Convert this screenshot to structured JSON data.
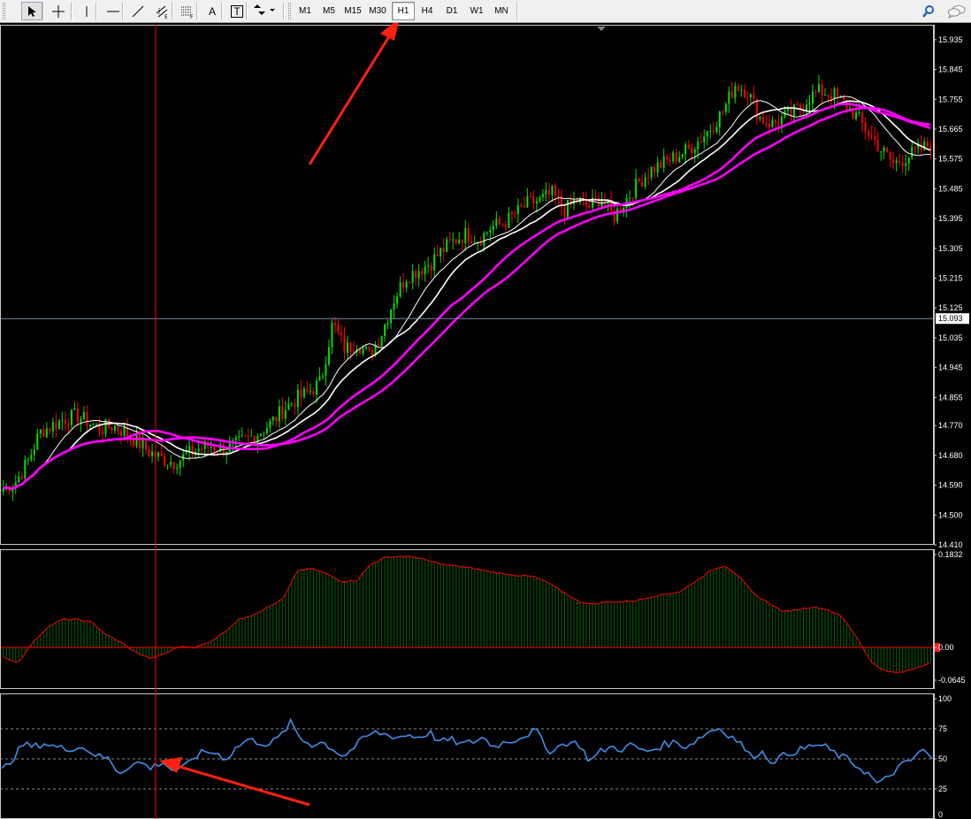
{
  "toolbar": {
    "tools": [
      {
        "name": "cursor-tool-button",
        "icon": "cursor-arrow-icon",
        "active": true
      },
      {
        "name": "crosshair-tool-button",
        "icon": "crosshair-icon",
        "active": false
      },
      {
        "name": "vertical-line-button",
        "icon": "vertical-line-icon",
        "active": false
      },
      {
        "name": "horizontal-line-button",
        "icon": "horizontal-line-icon",
        "active": false
      },
      {
        "name": "trendline-button",
        "icon": "trendline-icon",
        "active": false
      },
      {
        "name": "equidistant-channel-button",
        "icon": "channel-icon",
        "active": false
      },
      {
        "name": "fibonacci-button",
        "icon": "fibonacci-icon",
        "active": false
      },
      {
        "name": "text-tool-button",
        "icon": "text-icon",
        "active": false
      },
      {
        "name": "text-label-button",
        "icon": "text-label-icon",
        "active": false
      },
      {
        "name": "arrows-dropdown-button",
        "icon": "arrows-icon",
        "active": false
      }
    ],
    "text_tool_label": "A",
    "text_label_label": "T",
    "timeframes": [
      "M1",
      "M5",
      "M15",
      "M30",
      "H1",
      "H4",
      "D1",
      "W1",
      "MN"
    ],
    "active_timeframe": "H1",
    "right_icons": [
      "search-icon",
      "chat-icon"
    ]
  },
  "main_panel": {
    "price_labels": [
      "15.935",
      "15.845",
      "15.755",
      "15.665",
      "15.575",
      "15.485",
      "15.395",
      "15.305",
      "15.215",
      "15.125",
      "15.035",
      "14.945",
      "14.855",
      "14.770",
      "14.680",
      "14.590",
      "14.500",
      "14.410"
    ],
    "current_price_label": "15.093",
    "colors": {
      "bull": "#00e000",
      "bear": "#ff0000",
      "fast_ma": "#ffffff",
      "slow_ma": "#ff00ff",
      "crosshair_vertical": "#ff0000",
      "crosshair_horizontal": "#7a88aa"
    }
  },
  "macd_panel": {
    "labels": [
      "0.1832",
      "0.00",
      "-0.0645"
    ],
    "colors": {
      "hist_up": "#006400",
      "signal": "#ff0000",
      "zero_line": "#ff0000"
    }
  },
  "rsi_panel": {
    "labels": [
      "100",
      "75",
      "50",
      "25",
      "0"
    ],
    "colors": {
      "line": "#3e8ee8"
    }
  },
  "annotations": {
    "color": "#ff2010",
    "arrows": [
      {
        "name": "arrow-to-h1-timeframe",
        "points_to": "H1"
      },
      {
        "name": "arrow-to-rsi-crossing",
        "points_to": "RSI 50"
      }
    ]
  },
  "chart_data": [
    {
      "type": "candlestick",
      "title": "",
      "ylim": [
        14.41,
        15.98
      ],
      "y_ticks": [
        15.935,
        15.845,
        15.755,
        15.665,
        15.575,
        15.485,
        15.395,
        15.305,
        15.215,
        15.125,
        15.035,
        14.945,
        14.855,
        14.77,
        14.68,
        14.59,
        14.5,
        14.41
      ],
      "current_price": 15.093,
      "close_path": [
        14.58,
        14.6,
        14.66,
        14.75,
        14.77,
        14.79,
        14.8,
        14.78,
        14.76,
        14.77,
        14.75,
        14.72,
        14.69,
        14.67,
        14.66,
        14.68,
        14.7,
        14.71,
        14.7,
        14.71,
        14.73,
        14.75,
        14.78,
        14.82,
        14.85,
        14.87,
        14.9,
        15.08,
        15.0,
        15.02,
        14.98,
        15.05,
        15.15,
        15.22,
        15.24,
        15.26,
        15.3,
        15.33,
        15.35,
        15.33,
        15.37,
        15.38,
        15.41,
        15.44,
        15.45,
        15.47,
        15.42,
        15.45,
        15.43,
        15.46,
        15.4,
        15.45,
        15.5,
        15.54,
        15.56,
        15.58,
        15.6,
        15.63,
        15.67,
        15.72,
        15.8,
        15.78,
        15.7,
        15.68,
        15.7,
        15.72,
        15.76,
        15.78,
        15.77,
        15.74,
        15.7,
        15.65,
        15.6,
        15.56,
        15.58,
        15.6,
        15.62
      ],
      "moving_averages": [
        "fast",
        "fast",
        "slow",
        "slow"
      ]
    },
    {
      "type": "bar",
      "name": "MACD",
      "ylim": [
        -0.0645,
        0.1832
      ],
      "y_ticks": [
        0.1832,
        0.0,
        -0.0645
      ],
      "hist_path": [
        -0.02,
        -0.03,
        0.01,
        0.04,
        0.055,
        0.055,
        0.05,
        0.025,
        0.01,
        -0.01,
        -0.022,
        -0.012,
        0.002,
        0.0,
        0.01,
        0.03,
        0.055,
        0.065,
        0.08,
        0.095,
        0.152,
        0.155,
        0.145,
        0.13,
        0.132,
        0.165,
        0.178,
        0.18,
        0.178,
        0.17,
        0.163,
        0.16,
        0.155,
        0.15,
        0.145,
        0.142,
        0.14,
        0.128,
        0.11,
        0.092,
        0.085,
        0.09,
        0.09,
        0.092,
        0.1,
        0.105,
        0.11,
        0.13,
        0.15,
        0.162,
        0.14,
        0.105,
        0.088,
        0.07,
        0.075,
        0.08,
        0.075,
        0.06,
        0.02,
        -0.03,
        -0.048,
        -0.05,
        -0.04,
        -0.03
      ]
    },
    {
      "type": "line",
      "name": "RSI",
      "ylim": [
        0,
        100
      ],
      "y_ticks": [
        100,
        75,
        50,
        25,
        0
      ],
      "levels": [
        75,
        50,
        25
      ],
      "values": [
        40,
        50,
        62,
        60,
        63,
        60,
        58,
        60,
        58,
        52,
        50,
        38,
        45,
        47,
        42,
        48,
        40,
        42,
        52,
        56,
        55,
        50,
        60,
        66,
        64,
        62,
        68,
        80,
        66,
        62,
        64,
        58,
        52,
        60,
        68,
        72,
        70,
        68,
        70,
        68,
        72,
        64,
        66,
        62,
        64,
        68,
        60,
        64,
        66,
        70,
        74,
        56,
        60,
        64,
        62,
        48,
        56,
        60,
        58,
        62,
        56,
        58,
        62,
        64,
        60,
        66,
        72,
        76,
        70,
        64,
        52,
        56,
        48,
        52,
        56,
        58,
        62,
        60,
        54,
        50,
        44,
        38,
        28,
        36,
        44,
        48,
        58,
        50
      ]
    }
  ]
}
